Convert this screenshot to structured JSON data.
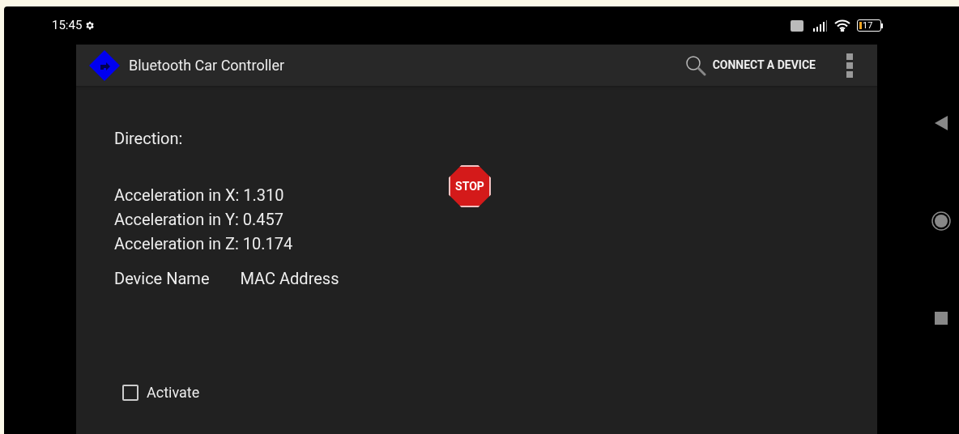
{
  "status_bar": {
    "time": "15:45",
    "battery": "17"
  },
  "app_bar": {
    "title": "Bluetooth Car Controller",
    "action": "CONNECT A DEVICE"
  },
  "direction_label": "Direction:",
  "stop_sign": "STOP",
  "accelerations": [
    "Acceleration in X: 1.310",
    "Acceleration in Y: 0.457",
    "Acceleration in Z: 10.174"
  ],
  "device_columns": [
    "Device Name",
    "MAC Address"
  ],
  "activate": {
    "label": "Activate",
    "checked": false
  }
}
